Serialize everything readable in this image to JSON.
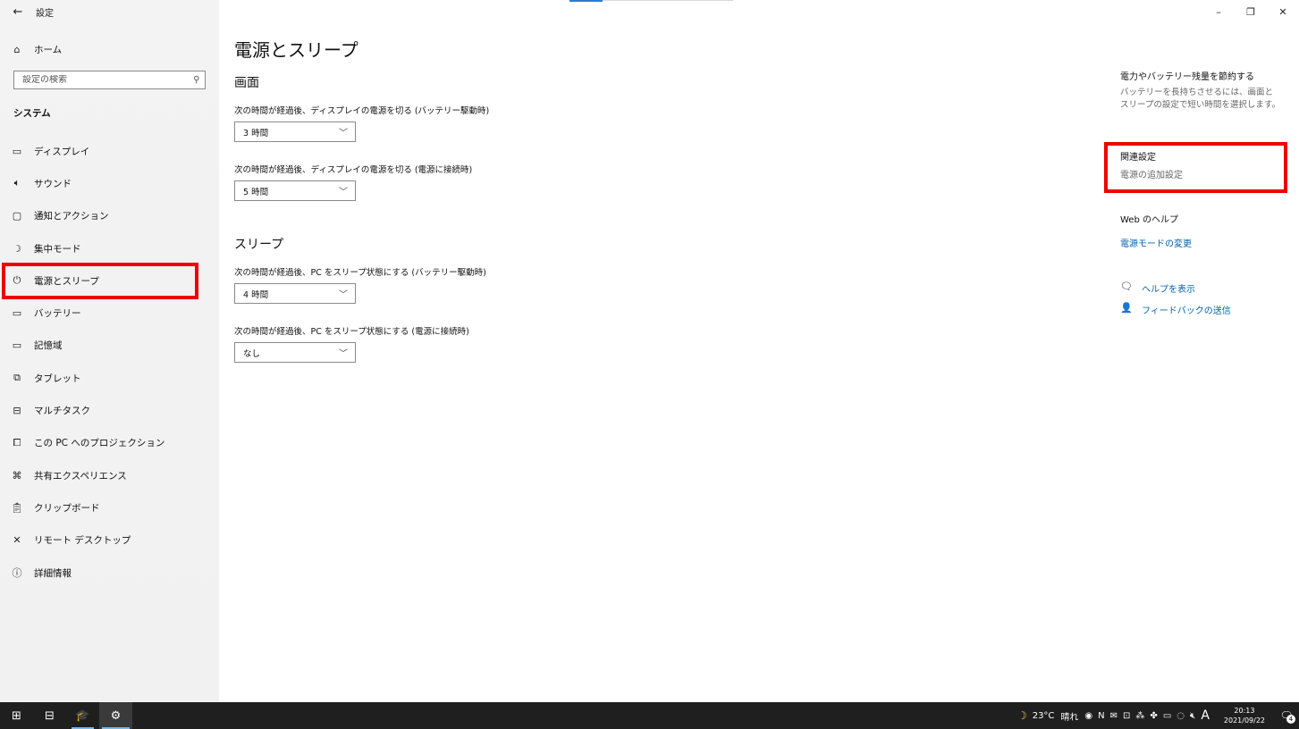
{
  "titlebar": {
    "back_icon": "←",
    "app_title": "設定"
  },
  "window_controls": {
    "minimize": "–",
    "restore": "❐",
    "close": "✕"
  },
  "sidebar": {
    "home": {
      "icon": "⌂",
      "label": "ホーム"
    },
    "search": {
      "placeholder": "設定の検索",
      "icon": "⚲"
    },
    "section_title": "システム",
    "items": [
      {
        "icon": "▭",
        "label": "ディスプレイ"
      },
      {
        "icon": "🔈︎",
        "label": "サウンド"
      },
      {
        "icon": "▢",
        "label": "通知とアクション"
      },
      {
        "icon": "☽",
        "label": "集中モード"
      },
      {
        "icon": "⏻",
        "label": "電源とスリープ"
      },
      {
        "icon": "▭",
        "label": "バッテリー"
      },
      {
        "icon": "▭",
        "label": "記憶域"
      },
      {
        "icon": "⧉",
        "label": "タブレット"
      },
      {
        "icon": "⊟",
        "label": "マルチタスク"
      },
      {
        "icon": "⧠",
        "label": "この PC へのプロジェクション"
      },
      {
        "icon": "⌘",
        "label": "共有エクスペリエンス"
      },
      {
        "icon": "📋︎",
        "label": "クリップボード"
      },
      {
        "icon": "✕",
        "label": "リモート デスクトップ"
      },
      {
        "icon": "ⓘ",
        "label": "詳細情報"
      }
    ]
  },
  "main": {
    "title": "電源とスリープ",
    "screen": {
      "heading": "画面",
      "battery_label": "次の時間が経過後、ディスプレイの電源を切る (バッテリー駆動時)",
      "battery_value": "3 時間",
      "plugged_label": "次の時間が経過後、ディスプレイの電源を切る (電源に接続時)",
      "plugged_value": "5 時間"
    },
    "sleep": {
      "heading": "スリープ",
      "battery_label": "次の時間が経過後、PC をスリープ状態にする (バッテリー駆動時)",
      "battery_value": "4 時間",
      "plugged_label": "次の時間が経過後、PC をスリープ状態にする (電源に接続時)",
      "plugged_value": "なし"
    },
    "dropdown_arrow": "﹀"
  },
  "right_panel": {
    "save_heading": "電力やバッテリー残量を節約する",
    "save_desc": "バッテリーを長持ちさせるには、画面とスリープの設定で短い時間を選択します。",
    "related_heading": "関連設定",
    "related_link": "電源の追加設定",
    "web_help_heading": "Web のヘルプ",
    "web_help_link": "電源モードの変更",
    "help_icon": "🗨",
    "help_link": "ヘルプを表示",
    "feedback_icon": "👤",
    "feedback_link": "フィードバックの送信"
  },
  "taskbar": {
    "start_icon": "⊞",
    "taskview_icon": "⊟",
    "app1_icon": "🎓",
    "settings_icon": "⚙",
    "weather_icon": "☽",
    "temperature": "23°C",
    "weather": "晴れ",
    "tray_icons": [
      "◉",
      "N",
      "✉",
      "⊡",
      "⁂",
      "✤",
      "▭",
      "◌",
      "🔇︎"
    ],
    "ime": "A",
    "time": "20:13",
    "date": "2021/09/22",
    "notification_icon": "🗨",
    "notification_count": "4"
  }
}
